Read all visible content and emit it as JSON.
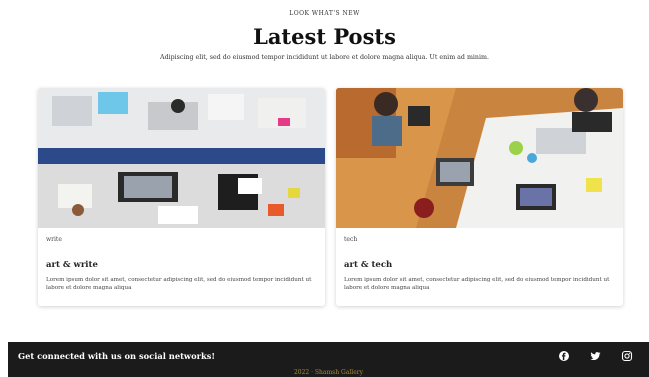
{
  "header": {
    "eyebrow": "LOOK WHAT'S NEW",
    "title": "Latest Posts",
    "subtitle": "Adipiscing elit, sed do eiusmod tempor incididunt ut labore et dolore magna aliqua. Ut enim ad minim."
  },
  "posts": [
    {
      "tag": "write",
      "title": "art & write",
      "excerpt": "Lorem ipsum dolor sit amet, consectetur adipiscing elit, sed do eiusmod tempor incididunt ut labore et dolore magna aliqua"
    },
    {
      "tag": "tech",
      "title": "art & tech",
      "excerpt": "Lorem ipsum dolor sit amet, consectetur adipiscing elit, sed do eiusmod tempor incididunt ut labore et dolore magna aliqua"
    }
  ],
  "footer": {
    "social_text": "Get connected with us on social networks!",
    "copyright": "2022 · Shamsh Gallery",
    "icons": [
      "facebook-icon",
      "twitter-icon",
      "instagram-icon"
    ]
  },
  "colors": {
    "footer_bg": "#1c1b1b",
    "copyright": "#a98a3a"
  }
}
